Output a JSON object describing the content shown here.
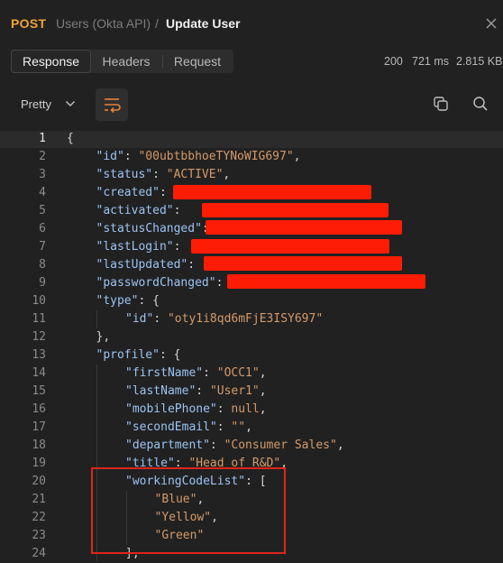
{
  "header": {
    "method": "POST",
    "collection": "Users (Okta API)",
    "separator": "/",
    "request_name": "Update User",
    "icons": {
      "close": "close-icon"
    }
  },
  "tabs": [
    {
      "label": "Response",
      "active": true
    },
    {
      "label": "Headers",
      "active": false
    },
    {
      "label": "Request",
      "active": false
    }
  ],
  "stats": {
    "status": "200",
    "time": "721 ms",
    "size": "2.815 KB"
  },
  "toolbar": {
    "view_mode": "Pretty",
    "icons": {
      "dropdown": "chevron-down-icon",
      "wrap": "word-wrap-icon",
      "copy": "copy-icon",
      "search": "search-icon"
    }
  },
  "editor": {
    "current_line": 1,
    "lines": [
      {
        "n": "1",
        "text": "{"
      },
      {
        "n": "2",
        "key": "\"id\"",
        "value": "\"00ubtbbhoeTYNoWIG697\"",
        "tail": ","
      },
      {
        "n": "3",
        "key": "\"status\"",
        "value": "\"ACTIVE\"",
        "tail": ","
      },
      {
        "n": "4",
        "key": "\"created\"",
        "redacted": true
      },
      {
        "n": "5",
        "key": "\"activated\"",
        "redacted": true
      },
      {
        "n": "6",
        "key": "\"statusChanged\"",
        "redacted": true
      },
      {
        "n": "7",
        "key": "\"lastLogin\"",
        "redacted": true
      },
      {
        "n": "8",
        "key": "\"lastUpdated\"",
        "redacted": true
      },
      {
        "n": "9",
        "key": "\"passwordChanged\"",
        "redacted": true
      },
      {
        "n": "10",
        "key": "\"type\"",
        "open": "{"
      },
      {
        "n": "11",
        "key": "\"id\"",
        "value": "\"oty1i8qd6mFjE3ISY697\""
      },
      {
        "n": "12",
        "text": "},"
      },
      {
        "n": "13",
        "key": "\"profile\"",
        "open": "{"
      },
      {
        "n": "14",
        "key": "\"firstName\"",
        "value": "\"OCC1\"",
        "tail": ","
      },
      {
        "n": "15",
        "key": "\"lastName\"",
        "value": "\"User1\"",
        "tail": ","
      },
      {
        "n": "16",
        "key": "\"mobilePhone\"",
        "value": "null",
        "tail": ","
      },
      {
        "n": "17",
        "key": "\"secondEmail\"",
        "value": "\"\"",
        "tail": ","
      },
      {
        "n": "18",
        "key": "\"department\"",
        "value": "\"Consumer Sales\"",
        "tail": ","
      },
      {
        "n": "19",
        "key": "\"title\"",
        "value": "\"Head of R&D\"",
        "tail": ","
      },
      {
        "n": "20",
        "key": "\"workingCodeList\"",
        "open": "["
      },
      {
        "n": "21",
        "value": "\"Blue\"",
        "tail": ","
      },
      {
        "n": "22",
        "value": "\"Yellow\"",
        "tail": ","
      },
      {
        "n": "23",
        "value": "\"Green\""
      },
      {
        "n": "24",
        "text": "],"
      }
    ]
  },
  "annotation_color": "#e0251b",
  "redaction_color": "#ff1c05"
}
